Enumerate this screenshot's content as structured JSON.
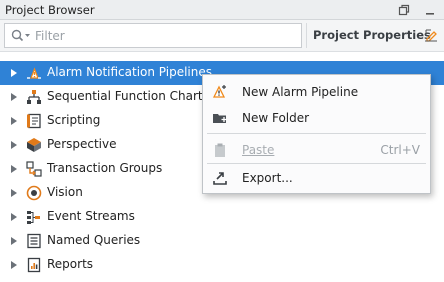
{
  "window": {
    "title": "Project Browser"
  },
  "filter": {
    "placeholder": "Filter"
  },
  "toolbar": {
    "properties_label": "Project Properties"
  },
  "tree": {
    "items": [
      {
        "label": "Alarm Notification Pipelines",
        "icon": "alarm-pipeline-icon",
        "selected": true
      },
      {
        "label": "Sequential Function Charts",
        "icon": "sfc-icon"
      },
      {
        "label": "Scripting",
        "icon": "scripting-icon"
      },
      {
        "label": "Perspective",
        "icon": "perspective-icon"
      },
      {
        "label": "Transaction Groups",
        "icon": "transaction-groups-icon"
      },
      {
        "label": "Vision",
        "icon": "vision-icon"
      },
      {
        "label": "Event Streams",
        "icon": "event-streams-icon"
      },
      {
        "label": "Named Queries",
        "icon": "named-queries-icon"
      },
      {
        "label": "Reports",
        "icon": "reports-icon"
      }
    ]
  },
  "context_menu": {
    "items": [
      {
        "label": "New Alarm Pipeline",
        "icon": "new-pipeline-icon",
        "enabled": true
      },
      {
        "label": "New Folder",
        "icon": "new-folder-icon",
        "enabled": true
      },
      {
        "label": "Paste",
        "icon": "paste-icon",
        "shortcut": "Ctrl+V",
        "enabled": false
      },
      {
        "label": "Export...",
        "icon": "export-icon",
        "enabled": true
      }
    ]
  },
  "colors": {
    "selection": "#2f82d6",
    "accent_orange": "#f08a1c"
  }
}
